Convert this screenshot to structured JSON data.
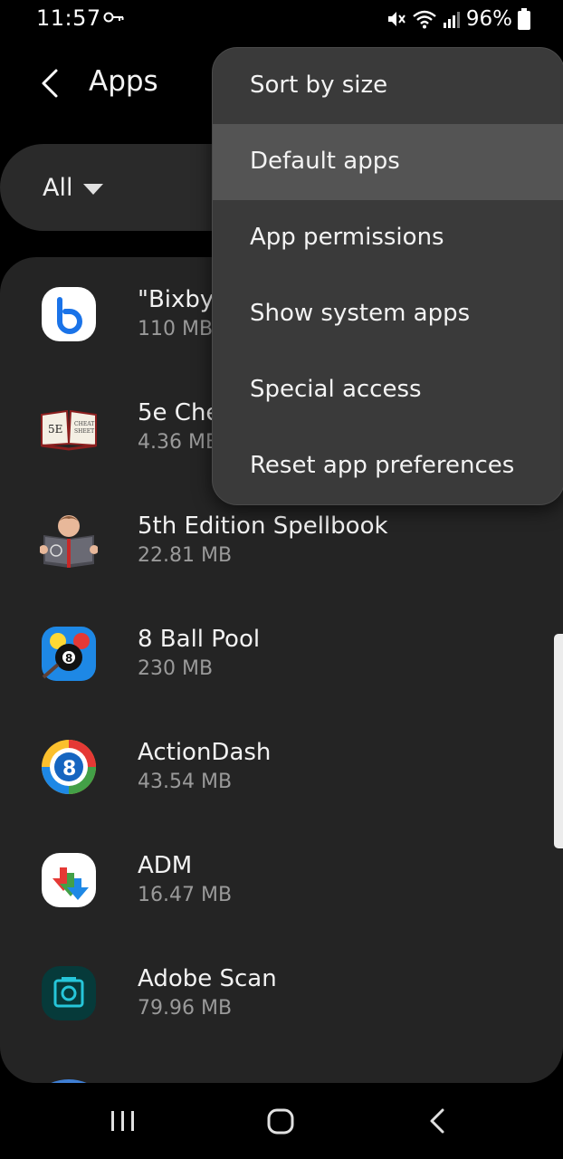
{
  "status_bar": {
    "time": "11:57",
    "battery": "96%",
    "icons": [
      "key-icon",
      "mute-icon",
      "wifi-icon",
      "signal-icon",
      "battery-icon"
    ]
  },
  "header": {
    "title": "Apps",
    "back_icon": "back-arrow-icon"
  },
  "filter": {
    "value": "All",
    "icon": "dropdown-caret-icon"
  },
  "apps": [
    {
      "name": "\"Bixby\"",
      "size": "110 MB",
      "icon": "bixby-app-icon"
    },
    {
      "name": "5e Che",
      "size": "4.36 MB",
      "icon": "5e-cheat-sheet-app-icon"
    },
    {
      "name": "5th Edition Spellbook",
      "size": "22.81 MB",
      "icon": "spellbook-app-icon"
    },
    {
      "name": "8 Ball Pool",
      "size": "230 MB",
      "icon": "8-ball-pool-app-icon"
    },
    {
      "name": "ActionDash",
      "size": "43.54 MB",
      "icon": "actiondash-app-icon"
    },
    {
      "name": "ADM",
      "size": "16.47 MB",
      "icon": "adm-app-icon"
    },
    {
      "name": "Adobe Scan",
      "size": "79.96 MB",
      "icon": "adobe-scan-app-icon"
    }
  ],
  "overflow_menu": {
    "items": [
      {
        "label": "Sort by size"
      },
      {
        "label": "Default apps",
        "highlighted": true
      },
      {
        "label": "App permissions"
      },
      {
        "label": "Show system apps"
      },
      {
        "label": "Special access"
      },
      {
        "label": "Reset app preferences"
      }
    ]
  },
  "nav_bar": {
    "buttons": [
      "recents-icon",
      "home-icon",
      "back-icon"
    ]
  },
  "colors": {
    "background": "#000000",
    "card": "#242424",
    "menu": "#3a3a3a",
    "menu_highlight": "#545454",
    "secondary_text": "#9a9a9a"
  }
}
